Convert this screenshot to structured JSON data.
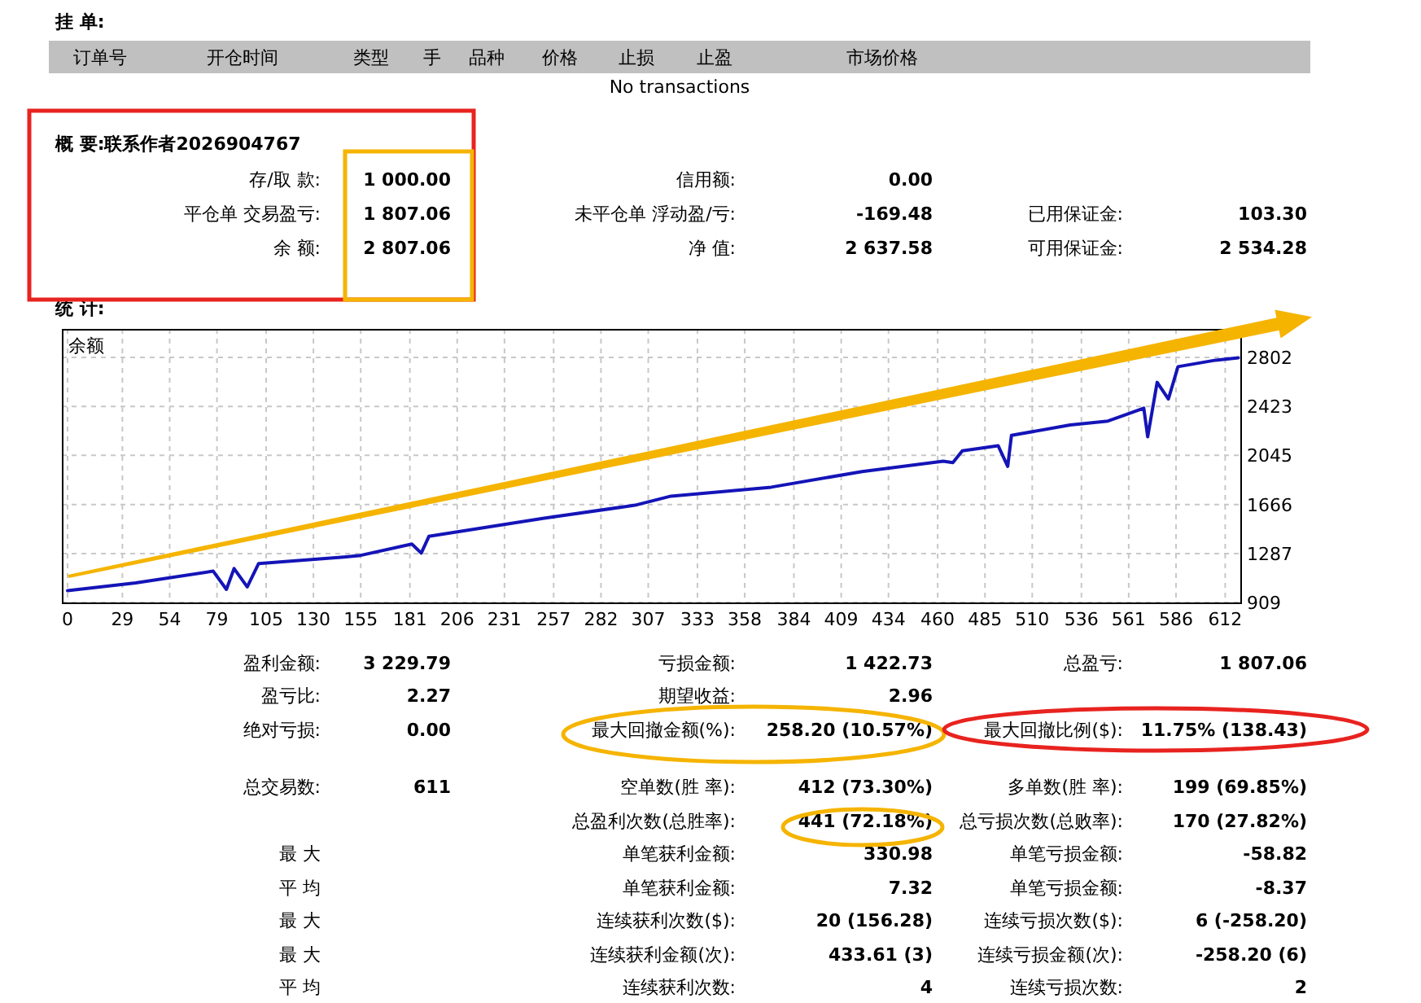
{
  "pending": {
    "title": "挂 单:",
    "columns": [
      "订单号",
      "开仓时间",
      "类型",
      "手",
      "品种",
      "价格",
      "止损",
      "止盈",
      "市场价格"
    ],
    "empty_text": "No transactions"
  },
  "summary": {
    "title": "概 要:联系作者2026904767",
    "rows": [
      {
        "left": {
          "label": "存/取 款:",
          "value": "1 000.00"
        },
        "middle": {
          "label": "信用额:",
          "value": "0.00"
        }
      },
      {
        "left": {
          "label": "平仓单 交易盈亏:",
          "value": "1 807.06"
        },
        "middle": {
          "label": "未平仓单 浮动盈/亏:",
          "value": "-169.48"
        },
        "right": {
          "label": "已用保证金:",
          "value": "103.30"
        }
      },
      {
        "left": {
          "label": "余 额:",
          "value": "2 807.06"
        },
        "middle": {
          "label": "净 值:",
          "value": "2 637.58"
        },
        "right": {
          "label": "可用保证金:",
          "value": "2 534.28"
        }
      }
    ]
  },
  "statistics": {
    "title": "统 计:",
    "chart_data": {
      "type": "line",
      "grid": true,
      "xlim": [
        -3,
        620
      ],
      "ylim": [
        909,
        3022
      ],
      "xticks": [
        0,
        29,
        54,
        79,
        105,
        130,
        155,
        181,
        206,
        231,
        257,
        282,
        307,
        333,
        358,
        384,
        409,
        434,
        460,
        485,
        510,
        536,
        561,
        586,
        612
      ],
      "yticks": [
        909,
        1287,
        1666,
        2045,
        2423,
        2802
      ],
      "x": [
        0,
        36,
        77,
        84,
        88,
        95,
        101,
        146,
        154,
        182,
        187,
        191,
        252,
        300,
        319,
        372,
        420,
        463,
        468,
        473,
        492,
        497,
        499,
        530,
        550,
        569,
        571,
        576,
        582,
        587,
        607,
        619
      ],
      "series": [
        {
          "name": "余额",
          "color": "#1414b8",
          "values": [
            1000,
            1060,
            1150,
            1010,
            1170,
            1030,
            1210,
            1260,
            1270,
            1360,
            1290,
            1420,
            1560,
            1660,
            1730,
            1800,
            1920,
            2000,
            1990,
            2080,
            2120,
            1960,
            2200,
            2280,
            2310,
            2410,
            2190,
            2610,
            2480,
            2730,
            2780,
            2800
          ]
        }
      ]
    },
    "groups": [
      [
        {
          "left": {
            "label": "盈利金额:",
            "value": "3 229.79"
          },
          "middle": {
            "label": "亏损金额:",
            "value": "1 422.73"
          },
          "right": {
            "label": "总盈亏:",
            "value": "1 807.06"
          }
        },
        {
          "left": {
            "label": "盈亏比:",
            "value": "2.27"
          },
          "middle": {
            "label": "期望收益:",
            "value": "2.96"
          }
        },
        {
          "left": {
            "label": "绝对亏损:",
            "value": "0.00"
          },
          "middle": {
            "label": "最大回撤金额(%):",
            "value": "258.20 (10.57%)"
          },
          "right": {
            "label": "最大回撤比例($):",
            "value": "11.75% (138.43)"
          }
        }
      ],
      [
        {
          "left": {
            "label": "总交易数:",
            "value": "611"
          },
          "middle": {
            "label": "空单数(胜 率):",
            "value": "412 (73.30%)"
          },
          "right": {
            "label": "多单数(胜 率):",
            "value": "199 (69.85%)"
          }
        },
        {
          "middle": {
            "label": "总盈利次数(总胜率):",
            "value": "441 (72.18%)"
          },
          "right": {
            "label": "总亏损次数(总败率):",
            "value": "170 (27.82%)"
          }
        },
        {
          "left": {
            "label": "最 大"
          },
          "middle": {
            "label": "单笔获利金额:",
            "value": "330.98"
          },
          "right": {
            "label": "单笔亏损金额:",
            "value": "-58.82"
          }
        },
        {
          "left": {
            "label": "平 均"
          },
          "middle": {
            "label": "单笔获利金额:",
            "value": "7.32"
          },
          "right": {
            "label": "单笔亏损金额:",
            "value": "-8.37"
          }
        },
        {
          "left": {
            "label": "最 大"
          },
          "middle": {
            "label": "连续获利次数($):",
            "value": "20 (156.28)"
          },
          "right": {
            "label": "连续亏损次数($):",
            "value": "6 (-258.20)"
          }
        },
        {
          "left": {
            "label": "最 大"
          },
          "middle": {
            "label": "连续获利金额(次):",
            "value": "433.61 (3)"
          },
          "right": {
            "label": "连续亏损金额(次):",
            "value": "-258.20 (6)"
          }
        },
        {
          "left": {
            "label": "平 均"
          },
          "middle": {
            "label": "连续获利次数:",
            "value": "4"
          },
          "right": {
            "label": "连续亏损次数:",
            "value": "2"
          }
        }
      ]
    ]
  }
}
